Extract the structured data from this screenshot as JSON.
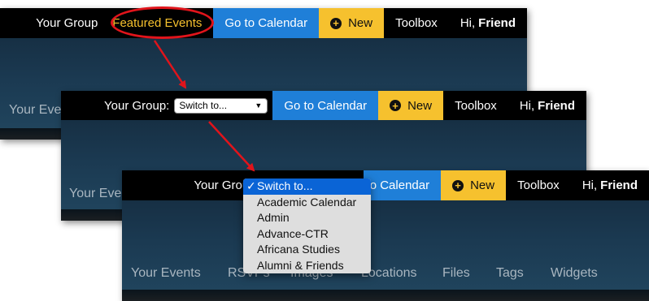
{
  "panel1": {
    "group_label": "Your Group",
    "featured": "Featured Events",
    "calendar": "Go to Calendar",
    "new_label": "New",
    "toolbox": "Toolbox",
    "greeting": "Hi,",
    "user": "Friend",
    "subnav_first": "Your Eve"
  },
  "panel2": {
    "group_label": "Your Group:",
    "select_value": "Switch to...",
    "calendar": "Go to Calendar",
    "new_label": "New",
    "toolbox": "Toolbox",
    "greeting": "Hi,",
    "user": "Friend",
    "subnav_first": "Your Eve"
  },
  "panel3": {
    "group_label": "Your Group:",
    "calendar": "o Calendar",
    "new_label": "New",
    "toolbox": "Toolbox",
    "greeting": "Hi,",
    "user": "Friend",
    "nav": [
      "Your Events",
      "RSVPs",
      "Images",
      "Locations",
      "Files",
      "Tags",
      "Widgets"
    ]
  },
  "dropdown": {
    "options": [
      "Switch to...",
      "Academic Calendar",
      "Admin",
      "Advance-CTR",
      "Africana Studies",
      "Alumni & Friends"
    ],
    "selected_index": 0
  },
  "colors": {
    "calendar_blue": "#1f7fd8",
    "new_yellow": "#f6c12e",
    "annotation_red": "#e1141b",
    "selected_blue": "#0a64d6"
  }
}
